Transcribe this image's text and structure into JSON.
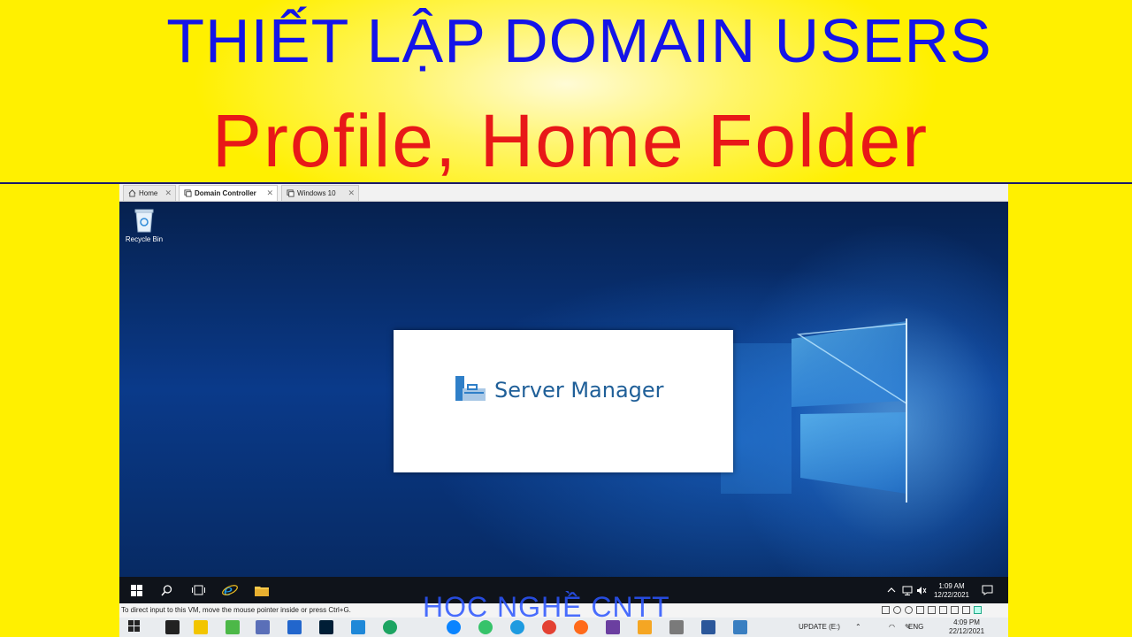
{
  "banner": {
    "title_line1": "THIẾT LẬP DOMAIN USERS",
    "title_line2": "Profile, Home Folder",
    "watermark": "HỌC NGHỀ CNTT"
  },
  "vm_tabs": [
    {
      "label": "Home",
      "active": false
    },
    {
      "label": "Domain Controller",
      "active": true
    },
    {
      "label": "Windows 10",
      "active": false
    }
  ],
  "desktop": {
    "recycle_bin_label": "Recycle Bin",
    "splash_title": "Server Manager"
  },
  "vm_taskbar": {
    "tray": {
      "time": "1:09 AM",
      "date": "12/22/2021"
    }
  },
  "vm_status": "To direct input to this VM, move the mouse pointer inside or press Ctrl+G.",
  "host_taskbar": {
    "update_label": "UPDATE (E:)",
    "language": "ENG",
    "time": "4:09 PM",
    "date": "22/12/2021"
  },
  "colors": {
    "banner_bg": "#fff000",
    "title1": "#1414e8",
    "title2": "#e81818",
    "desktop_bg": "#0a3a8a",
    "splash_text": "#1f5f98"
  }
}
